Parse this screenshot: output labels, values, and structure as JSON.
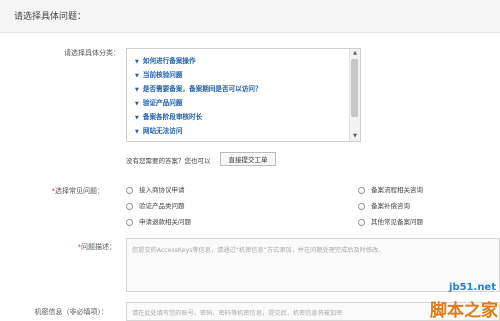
{
  "header": {
    "title": "请选择具体问题："
  },
  "category": {
    "label": "请选择具体分类：",
    "items": [
      "如何进行备案操作",
      "当前核验问题",
      "是否需要备案，备案期间是否可以访问？",
      "验证产品问题",
      "备案各阶段审核时长",
      "网站无法访问"
    ],
    "scroll_up": "▲",
    "scroll_down": "▼"
  },
  "no_answer": {
    "text": "没有您需要的答案？您也可以",
    "button_label": "直接提交工单"
  },
  "common_issue": {
    "star": "*",
    "label": "选择常见问题：",
    "options": [
      "接入商协议申请",
      "验证产品类问题",
      "申请退款相关问题",
      "备案流程相关咨询",
      "备案补偿咨询",
      "其他常见备案问题"
    ]
  },
  "description": {
    "star": "*",
    "label": "问题描述：",
    "placeholder": "您提交的AccessKeys等信息，请通过“机密信息”方式添加，并在问题处理完成后及时修改。"
  },
  "confidential": {
    "label": "机密信息（非必填项）：",
    "placeholder": "请在此处填写您的账号、密码、密码等机密信息，提交后，机密信息将被加密"
  },
  "watermark": {
    "site": "jb51.net",
    "name": "脚本之家"
  }
}
